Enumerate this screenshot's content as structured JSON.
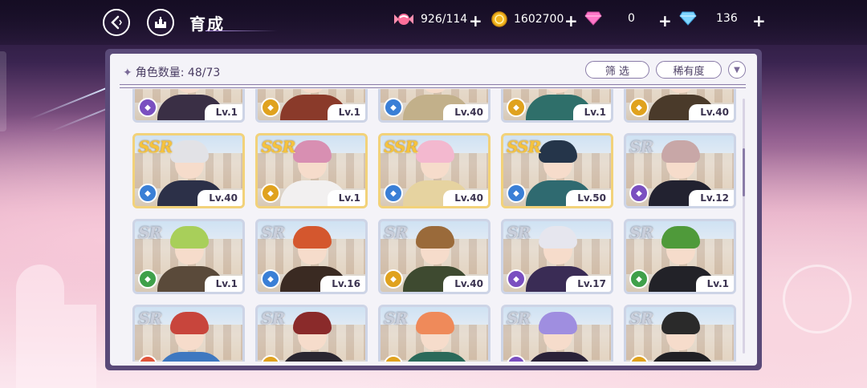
{
  "header": {
    "title": "育成",
    "back_icon": "back-arrow-icon",
    "home_icon": "castle-icon"
  },
  "resources": {
    "candy": {
      "icon": "candy-icon",
      "value": "926/114"
    },
    "coin": {
      "icon": "coin-icon",
      "value": "1602700"
    },
    "pink_gem": {
      "icon": "pink-diamond-icon",
      "value": "0"
    },
    "blue_gem": {
      "icon": "blue-diamond-icon",
      "value": "136"
    },
    "plus_label": "+"
  },
  "panel": {
    "count_label": "角色数量:",
    "count_value": "48/73",
    "filter_label": "筛 选",
    "sort_label": "稀有度",
    "sort_icon": "chevron-down-icon"
  },
  "colors": {
    "panel_frame": "#5a4a78",
    "ssr_gold": "#f6c33c",
    "sr_silver": "#c9cfdc"
  },
  "characters": [
    {
      "rarity": "",
      "level": "Lv.1",
      "element": "purple",
      "hair": "#e8dcc8",
      "outfit": "#3a2f45"
    },
    {
      "rarity": "",
      "level": "Lv.1",
      "element": "gold",
      "hair": "#f1e1c8",
      "outfit": "#8a3a2a"
    },
    {
      "rarity": "",
      "level": "Lv.40",
      "element": "blue",
      "hair": "#e8d9b0",
      "outfit": "#c2b08a"
    },
    {
      "rarity": "",
      "level": "Lv.1",
      "element": "gold",
      "hair": "#2f3a50",
      "outfit": "#2f6f6a"
    },
    {
      "rarity": "",
      "level": "Lv.40",
      "element": "gold",
      "hair": "#f2e3b8",
      "outfit": "#4a3a2a"
    },
    {
      "rarity": "SSR",
      "level": "Lv.40",
      "element": "blue",
      "hair": "#e2e2e6",
      "outfit": "#2c3048"
    },
    {
      "rarity": "SSR",
      "level": "Lv.1",
      "element": "gold",
      "hair": "#d88fb2",
      "outfit": "#f2f0f0"
    },
    {
      "rarity": "SSR",
      "level": "Lv.40",
      "element": "blue",
      "hair": "#f3b8cf",
      "outfit": "#e6d3a0"
    },
    {
      "rarity": "SSR",
      "level": "Lv.50",
      "element": "blue",
      "hair": "#25354a",
      "outfit": "#2f6a70"
    },
    {
      "rarity": "SR",
      "level": "Lv.12",
      "element": "purple",
      "hair": "#c8a7a7",
      "outfit": "#222230"
    },
    {
      "rarity": "SR",
      "level": "Lv.1",
      "element": "green",
      "hair": "#a8cf5a",
      "outfit": "#5a4a3a"
    },
    {
      "rarity": "SR",
      "level": "Lv.16",
      "element": "blue",
      "hair": "#d4572e",
      "outfit": "#3a2a22"
    },
    {
      "rarity": "SR",
      "level": "Lv.40",
      "element": "gold",
      "hair": "#9a6a3a",
      "outfit": "#3e4a30"
    },
    {
      "rarity": "SR",
      "level": "Lv.17",
      "element": "purple",
      "hair": "#e6e6ee",
      "outfit": "#3a2c55"
    },
    {
      "rarity": "SR",
      "level": "Lv.1",
      "element": "green",
      "hair": "#4f9a3a",
      "outfit": "#222228"
    },
    {
      "rarity": "SR",
      "level": "",
      "element": "red",
      "hair": "#c8453c",
      "outfit": "#3e78c0"
    },
    {
      "rarity": "SR",
      "level": "",
      "element": "gold",
      "hair": "#8a2a2a",
      "outfit": "#2a2630"
    },
    {
      "rarity": "SR",
      "level": "",
      "element": "gold",
      "hair": "#ef8a5a",
      "outfit": "#2a6a5a"
    },
    {
      "rarity": "SR",
      "level": "",
      "element": "purple",
      "hair": "#9f8ee0",
      "outfit": "#2a2238"
    },
    {
      "rarity": "SR",
      "level": "",
      "element": "gold",
      "hair": "#2a2a2a",
      "outfit": "#202024"
    }
  ]
}
